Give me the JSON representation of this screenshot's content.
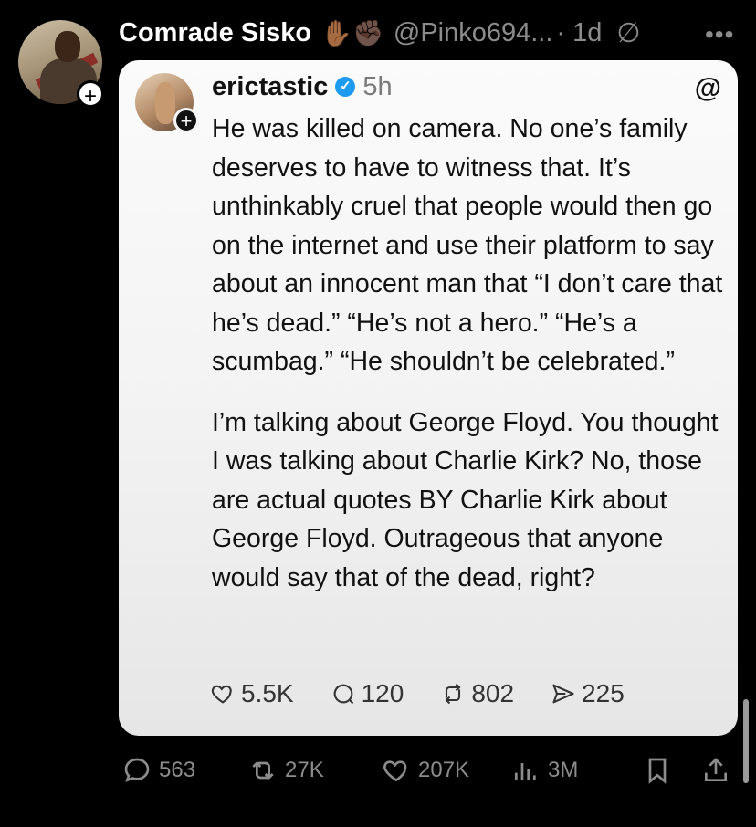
{
  "post": {
    "author_name": "Comrade Sisko",
    "emojis": "✋🏾✊🏿",
    "handle": "@Pinko694...",
    "time": "· 1d",
    "follow_symbol": "+"
  },
  "quoted": {
    "author_name": "erictastic",
    "verified_symbol": "✓",
    "time": "5h",
    "follow_symbol": "+",
    "paragraphs": [
      "He was killed on camera. No one’s family deserves to have to witness that. It’s unthinkably cruel that people would then go on the internet and use their platform to say about an innocent man that “I don’t care that he’s dead.” “He’s not a hero.” “He’s a scumbag.” “He shouldn’t be celebrated.”",
      "I’m talking about George Floyd. You thought I was talking about Charlie Kirk? No, those are actual quotes BY Charlie Kirk about George Floyd. Outrageous that anyone would say that of the dead, right?"
    ],
    "stats": {
      "likes": "5.5K",
      "replies": "120",
      "reposts": "802",
      "shares": "225"
    }
  },
  "actions": {
    "replies": "563",
    "reposts": "27K",
    "likes": "207K",
    "views": "3M"
  },
  "icons": [
    "more-icon",
    "mute-icon",
    "threads-logo-icon",
    "verified-icon",
    "heart-icon",
    "comment-icon",
    "repost-icon",
    "share-icon",
    "views-icon",
    "bookmark-icon"
  ]
}
